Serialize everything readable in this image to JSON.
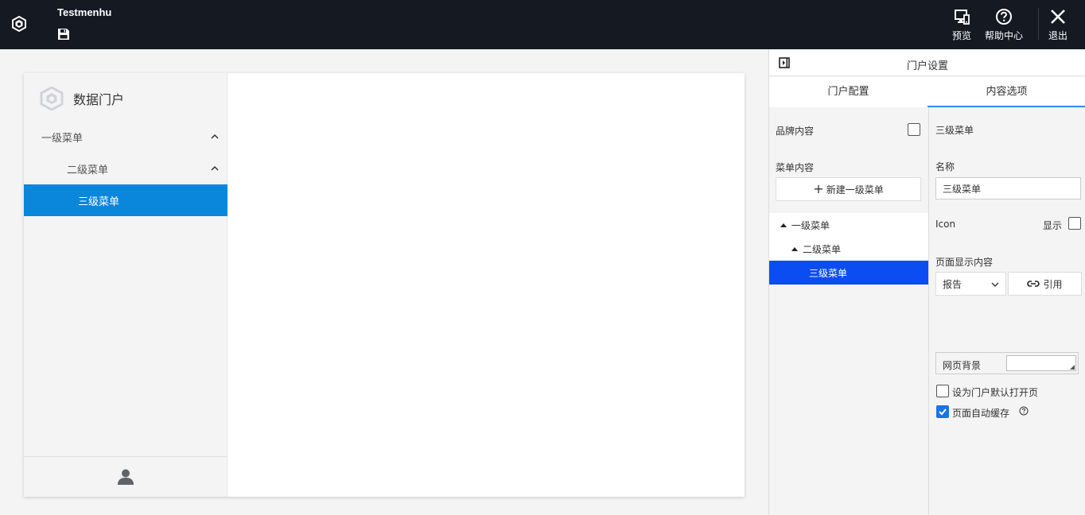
{
  "topbar": {
    "title": "Testmenhu",
    "buttons": {
      "preview": "预览",
      "help": "帮助中心",
      "exit": "退出"
    },
    "icons": {
      "logo": "portal-logo-icon",
      "save": "save-icon",
      "preview": "monitor-icon",
      "help": "help-circle-icon",
      "exit": "close-icon"
    }
  },
  "portal": {
    "brand": "数据门户",
    "menu": [
      {
        "label": "一级菜单",
        "level": 1,
        "expanded": true
      },
      {
        "label": "二级菜单",
        "level": 2,
        "expanded": true
      },
      {
        "label": "三级菜单",
        "level": 3,
        "active": true
      }
    ],
    "accent_color": "#0a86da"
  },
  "panel": {
    "title": "门户设置",
    "tabs": [
      {
        "label": "门户配置",
        "active": false
      },
      {
        "label": "内容选项",
        "active": true
      }
    ],
    "left": {
      "brand_label": "品牌内容",
      "brand_checked": false,
      "menu_label": "菜单内容",
      "new_button": "新建一级菜单",
      "tree": [
        {
          "label": "一级菜单",
          "level": 1
        },
        {
          "label": "二级菜单",
          "level": 2
        },
        {
          "label": "三级菜单",
          "level": 3,
          "active": true
        }
      ]
    },
    "right": {
      "header": "三级菜单",
      "name_label": "名称",
      "name_value": "三级菜单",
      "icon_label": "Icon",
      "show_label": "显示",
      "show_checked": false,
      "page_content_label": "页面显示内容",
      "content_type": "报告",
      "reference_button": "引用",
      "bg_label": "网页背景",
      "default_page_label": "设为门户默认打开页",
      "default_page_checked": false,
      "auto_cache_label": "页面自动缓存",
      "auto_cache_checked": true
    }
  }
}
